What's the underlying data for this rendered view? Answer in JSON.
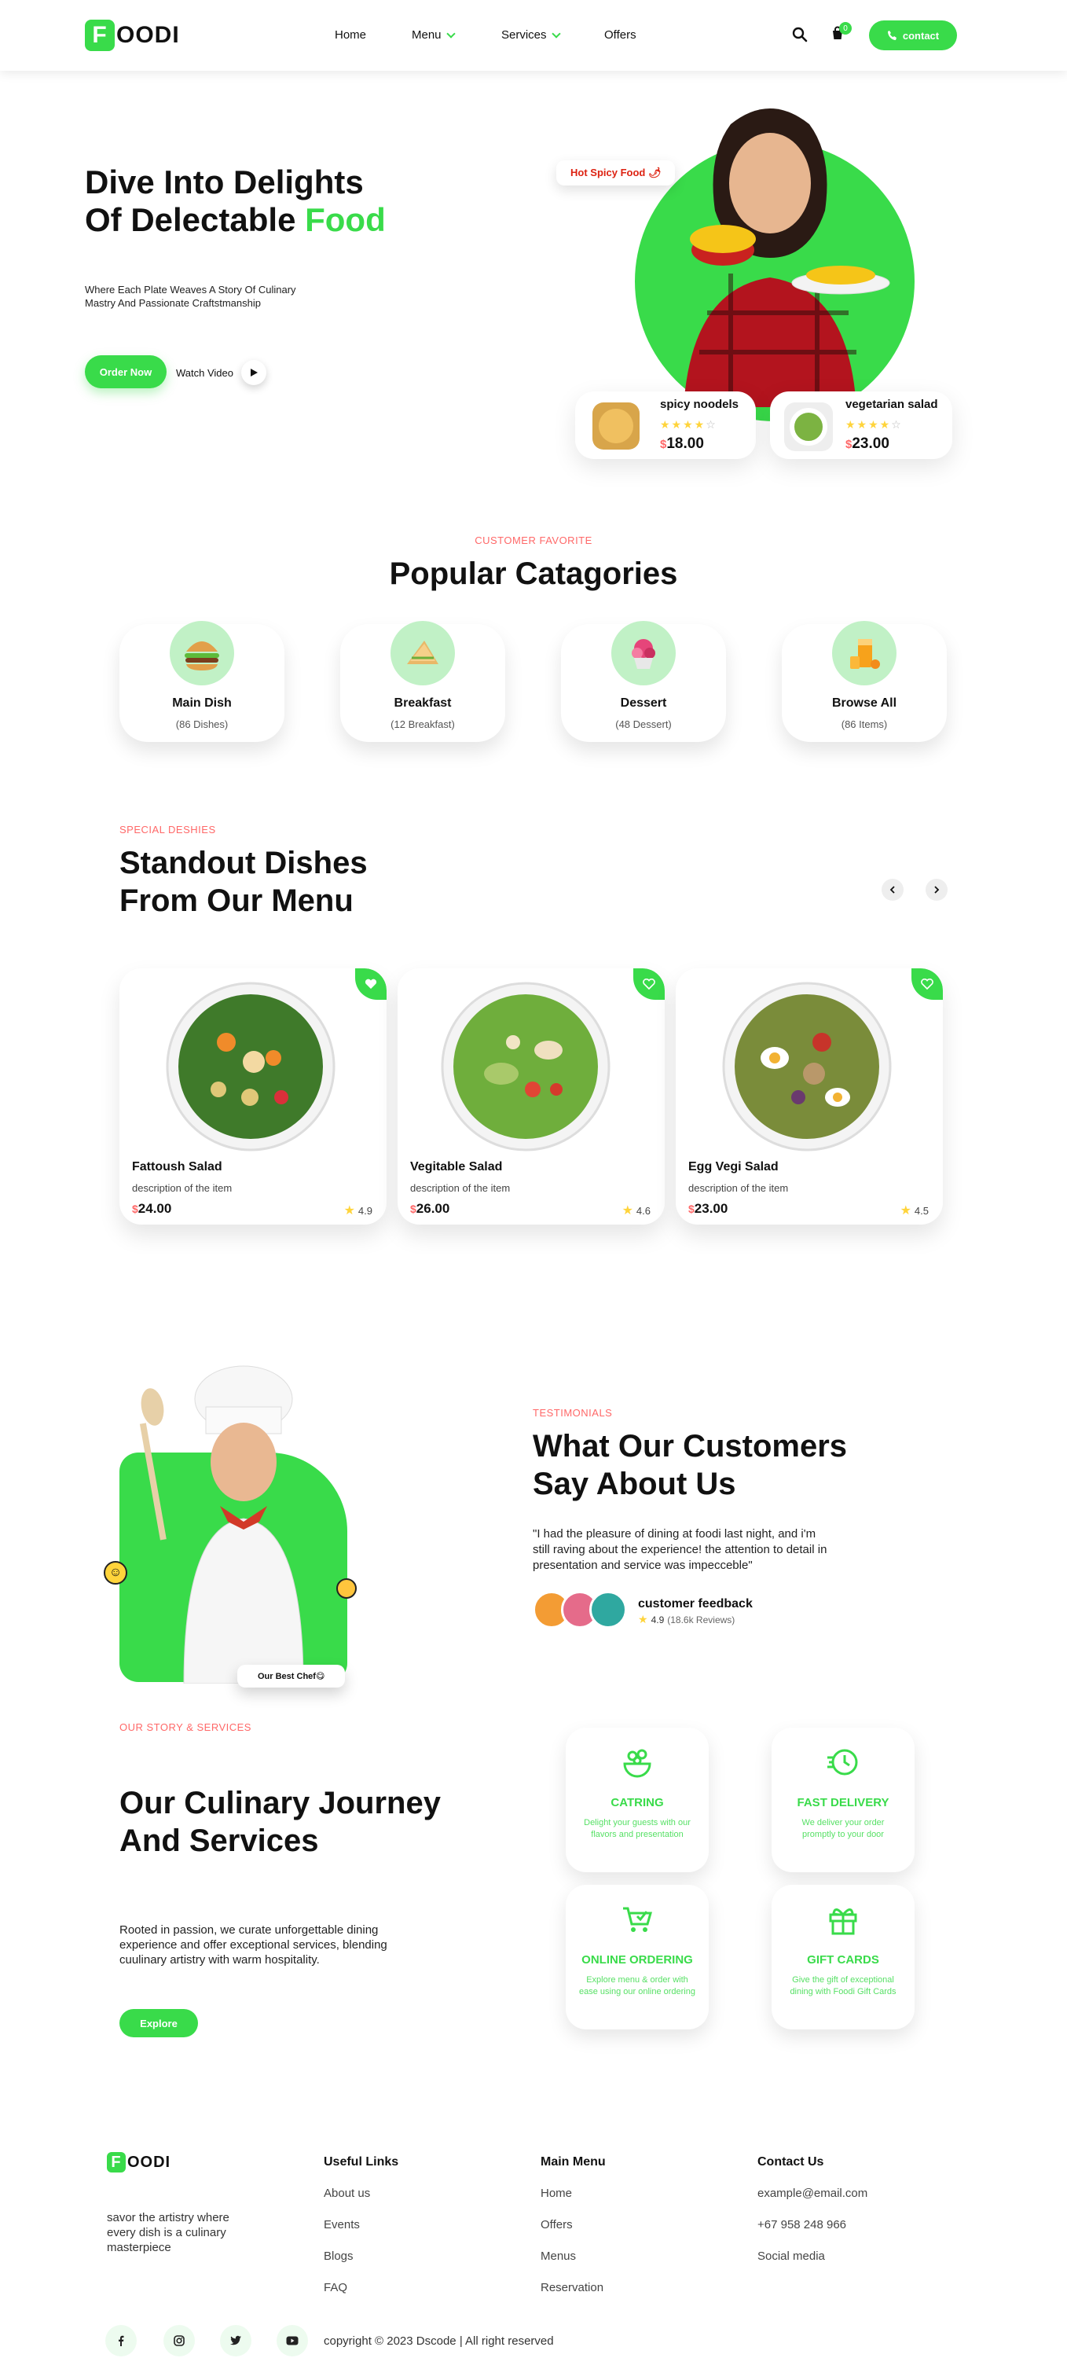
{
  "brand": {
    "logo_letter": "F",
    "logo_rest": "OODI",
    "accent": "#39DB4A",
    "tag_color": "#FF6868"
  },
  "nav": {
    "home": "Home",
    "menu": "Menu",
    "services": "Services",
    "offers": "Offers",
    "cart_count": "0",
    "contact": "contact"
  },
  "hero": {
    "title_line1": "Dive Into Delights",
    "title_line2_a": "Of Delectable ",
    "title_line2_b": "Food",
    "subtitle": "Where Each Plate Weaves A Story Of Culinary Mastry And Passionate Craftstmanship",
    "order_button": "Order Now",
    "watch_video": "Watch Video",
    "badge": "Hot Spicy Food 🌶",
    "cards": [
      {
        "name": "spicy noodels",
        "price_symbol": "$",
        "price": "18.00",
        "rating": 4
      },
      {
        "name": "vegetarian salad",
        "price_symbol": "$",
        "price": "23.00",
        "rating": 4
      }
    ]
  },
  "categories": {
    "tag": "Customer Favorite",
    "title": "Popular Catagories",
    "items": [
      {
        "name": "Main Dish",
        "count": "(86 Dishes)",
        "icon": "burger-icon"
      },
      {
        "name": "Breakfast",
        "count": "(12 Breakfast)",
        "icon": "sandwich-icon"
      },
      {
        "name": "Dessert",
        "count": "(48 Dessert)",
        "icon": "icecream-icon"
      },
      {
        "name": "Browse All",
        "count": "(86 Items)",
        "icon": "drink-icon"
      }
    ]
  },
  "specials": {
    "tag": "Special Deshies",
    "title_line1": "Standout Dishes",
    "title_line2": "From Our Menu",
    "items": [
      {
        "name": "Fattoush Salad",
        "desc": "description of the item",
        "price_symbol": "$",
        "price": "24.00",
        "rating": "4.9"
      },
      {
        "name": "Vegitable Salad",
        "desc": "description of the item",
        "price_symbol": "$",
        "price": "26.00",
        "rating": "4.6"
      },
      {
        "name": "Egg Vegi Salad",
        "desc": "description of the item",
        "price_symbol": "$",
        "price": "23.00",
        "rating": "4.5"
      }
    ]
  },
  "testimonials": {
    "tag": "Testimonials",
    "title_line1": "What Our Customers",
    "title_line2": "Say About Us",
    "quote": "\"I had the pleasure of dining at foodi last night, and i'm still raving about the experience! the attention to detail in presentation and service was impecceble\"",
    "feedback_label": "customer feedback",
    "rating": "4.9",
    "reviews": "(18.6k Reviews)",
    "chef_badge": "Our Best Chef😋"
  },
  "services": {
    "tag": "Our Story & Services",
    "title_line1": "Our Culinary Journey",
    "title_line2": "And Services",
    "body": "Rooted in passion, we curate unforgettable dining experience and offer exceptional services, blending cuulinary artistry with warm hospitality.",
    "explore": "Explore",
    "items": [
      {
        "title": "Catring",
        "desc": "Delight your guests with our flavors and presentation",
        "icon": "catering-icon"
      },
      {
        "title": "Fast Delivery",
        "desc": "We deliver your order promptly to your door",
        "icon": "clock-icon"
      },
      {
        "title": "Online Ordering",
        "desc": "Explore menu & order with ease using our online ordering",
        "icon": "cart-icon"
      },
      {
        "title": "Gift Cards",
        "desc": "Give the gift of exceptional dining with Foodi Gift Cards",
        "icon": "gift-icon"
      }
    ]
  },
  "footer": {
    "tagline": "savor the artistry where every dish is a culinary masterpiece",
    "useful_links_title": "Useful Links",
    "useful_links": [
      "About us",
      "Events",
      "Blogs",
      "FAQ"
    ],
    "main_menu_title": "Main Menu",
    "main_menu": [
      "Home",
      "Offers",
      "Menus",
      "Reservation"
    ],
    "contact_title": "Contact Us",
    "contact": [
      "example@email.com",
      "+67 958 248 966",
      "Social media"
    ],
    "copyright": "copyright © 2023 Dscode | All right reserved",
    "social": [
      "facebook-icon",
      "instagram-icon",
      "twitter-icon",
      "youtube-icon"
    ]
  }
}
